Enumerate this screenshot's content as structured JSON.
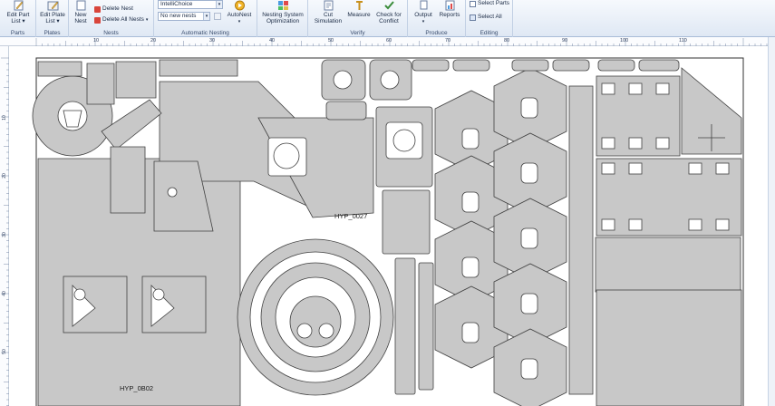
{
  "ribbon": {
    "groups": [
      {
        "label": "Parts",
        "buttons": [
          {
            "label": "Edit Part",
            "sub": "List"
          }
        ]
      },
      {
        "label": "Plates",
        "buttons": [
          {
            "label": "Edit Plate",
            "sub": "List"
          }
        ]
      },
      {
        "label": "Nests",
        "buttons": [
          {
            "label": "New",
            "sub": "Nest"
          }
        ],
        "small": [
          "Delete Nest",
          "Delete All Nests"
        ]
      },
      {
        "label": "Automatic Nesting",
        "combo1": "IntelliChoice",
        "combo2": "No new nests",
        "buttons": [
          {
            "label": "AutoNest",
            "sub": ""
          }
        ]
      },
      {
        "label": "",
        "buttons": [
          {
            "label": "Nesting System",
            "sub": "Optimization"
          }
        ]
      },
      {
        "label": "Verify",
        "buttons": [
          {
            "label": "Cut",
            "sub": "Simulation"
          },
          {
            "label": "Measure",
            "sub": ""
          },
          {
            "label": "Check for",
            "sub": "Conflict"
          }
        ]
      },
      {
        "label": "Produce",
        "buttons": [
          {
            "label": "Output",
            "sub": ""
          },
          {
            "label": "Reports",
            "sub": ""
          }
        ]
      },
      {
        "label": "Editing",
        "small": [
          "Select Parts",
          "Select All"
        ]
      }
    ]
  },
  "ruler": {
    "h_ticks": [
      "10",
      "20",
      "30",
      "40",
      "50",
      "60",
      "70",
      "80",
      "90",
      "100",
      "110"
    ],
    "v_ticks": [
      "10",
      "20",
      "30",
      "40",
      "50"
    ]
  },
  "nest": {
    "labels": [
      "HYP_0027",
      "HYP_0B02"
    ]
  },
  "colors": {
    "part_fill": "#c8c8c8",
    "part_stroke": "#404040",
    "sheet": "#ffffff"
  }
}
